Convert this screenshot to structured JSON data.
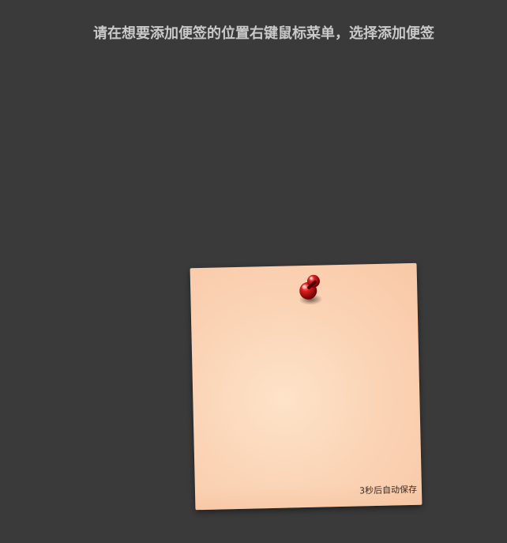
{
  "instruction": {
    "text": "请在想要添加便签的位置右键鼠标菜单，选择添加便签"
  },
  "note": {
    "save_status": "3秒后自动保存",
    "pin_icon": "push-pin-icon",
    "colors": {
      "background": "#3a3a3a",
      "note_light": "#fde3c9",
      "note_dark": "#f8c8a6",
      "pin": "#c91616"
    }
  }
}
